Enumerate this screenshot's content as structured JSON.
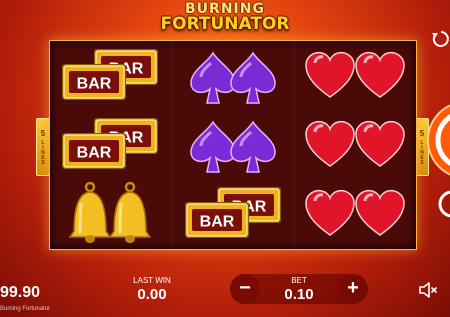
{
  "game": {
    "title_line1": "BURNING",
    "title_line2": "FORTUNATOR",
    "footer_name": "Burning Fortunator"
  },
  "paylines": {
    "count": "5",
    "word": "LINES"
  },
  "reels": [
    [
      "bar",
      "bar",
      "golden-bell"
    ],
    [
      "purple-spade",
      "purple-spade",
      "bar"
    ],
    [
      "red-heart",
      "red-heart",
      "red-heart"
    ]
  ],
  "symbol_text": {
    "bar": "BAR"
  },
  "hud": {
    "balance_value": "99.90",
    "last_win_label": "LAST WIN",
    "last_win_value": "0.00",
    "bet_label": "BET",
    "bet_value": "0.10",
    "minus_label": "−",
    "plus_label": "+"
  },
  "colors": {
    "accent_gold": "#ffc21a",
    "spin_orange": "#ff5a0a",
    "reel_bg": "#4a0a08"
  },
  "icons": {
    "autoplay": "autoplay-icon",
    "spin": "spin-icon",
    "turbo": "turbo-icon",
    "sound": "speaker-mute-icon"
  }
}
